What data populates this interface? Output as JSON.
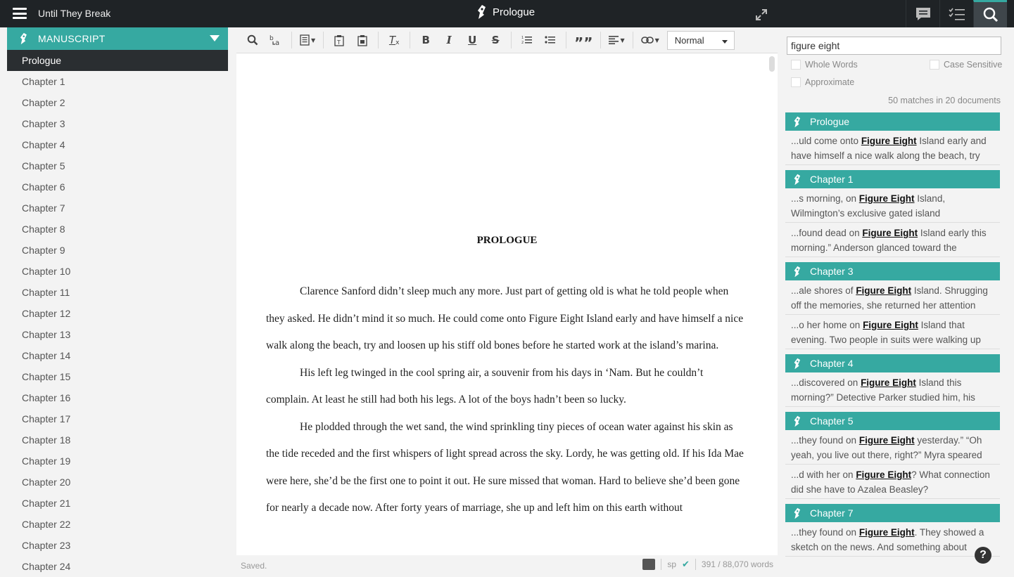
{
  "app": {
    "title": "Until They Break",
    "doc_title": "Prologue"
  },
  "sidebar": {
    "section_label": "MANUSCRIPT",
    "items": [
      "Prologue",
      "Chapter 1",
      "Chapter 2",
      "Chapter 3",
      "Chapter 4",
      "Chapter 5",
      "Chapter 6",
      "Chapter 7",
      "Chapter 8",
      "Chapter 9",
      "Chapter 10",
      "Chapter 11",
      "Chapter 12",
      "Chapter 13",
      "Chapter 14",
      "Chapter 15",
      "Chapter 16",
      "Chapter 17",
      "Chapter 18",
      "Chapter 19",
      "Chapter 20",
      "Chapter 21",
      "Chapter 22",
      "Chapter 23",
      "Chapter 24"
    ],
    "active_index": 0
  },
  "toolbar": {
    "style_select_value": "Normal"
  },
  "editor": {
    "heading": "PROLOGUE",
    "paragraphs": [
      "Clarence Sanford didn’t sleep much any more. Just part of getting old is what he told people when they asked. He didn’t mind it so much. He could come onto Figure Eight Island early and have himself a nice walk along the beach, try and loosen up his stiff old bones before he started work at the island’s marina.",
      "His left leg twinged in the cool spring air, a souvenir from his days in ‘Nam. But he couldn’t complain. At least he still had both his legs. A lot of the boys hadn’t been so lucky.",
      "He plodded through the wet sand, the wind sprinkling tiny pieces of ocean water against his skin as the tide receded and the first whispers of light spread across the sky. Lordy, he was getting old. If his Ida Mae were here, she’d be the first one to point it out. He sure missed that woman. Hard to believe she’d been gone for nearly a decade now. After forty years of marriage, she up and left him on this earth without"
    ]
  },
  "status": {
    "saved": "Saved.",
    "spell": "sp",
    "word_count": "391 / 88,070 words"
  },
  "search": {
    "query": "figure eight",
    "options": {
      "whole_words": "Whole Words",
      "case_sensitive": "Case Sensitive",
      "approximate": "Approximate"
    },
    "match_count": "50 matches in 20 documents",
    "results": [
      {
        "doc": "Prologue",
        "snippets": [
          {
            "pre": "...uld come onto ",
            "hl": "Figure Eight",
            "post": " Island early and have himself a nice walk along the beach, try"
          }
        ]
      },
      {
        "doc": "Chapter 1",
        "snippets": [
          {
            "pre": "...s morning, on ",
            "hl": "Figure Eight",
            "post": " Island, Wilmington’s exclusive gated island"
          },
          {
            "pre": "...found dead on ",
            "hl": "Figure Eight",
            "post": " Island early this morning.” Anderson glanced toward the"
          }
        ]
      },
      {
        "doc": "Chapter 3",
        "snippets": [
          {
            "pre": "...ale shores of ",
            "hl": "Figure Eight",
            "post": " Island. Shrugging off the memories, she returned her attention"
          },
          {
            "pre": "...o her home on ",
            "hl": "Figure Eight",
            "post": " Island that evening. Two people in suits were walking up"
          }
        ]
      },
      {
        "doc": "Chapter 4",
        "snippets": [
          {
            "pre": "...discovered on ",
            "hl": "Figure Eight",
            "post": " Island this morning?” Detective Parker studied him, his"
          }
        ]
      },
      {
        "doc": "Chapter 5",
        "snippets": [
          {
            "pre": "...they found on ",
            "hl": "Figure Eight",
            "post": " yesterday.” “Oh yeah, you live out there, right?” Myra speared"
          },
          {
            "pre": "...d with her on ",
            "hl": "Figure Eight",
            "post": "? What connection did she have to Azalea Beasley?"
          }
        ]
      },
      {
        "doc": "Chapter 7",
        "snippets": [
          {
            "pre": "...they found on ",
            "hl": "Figure Eight",
            "post": ". They showed a sketch on the news. And something about"
          }
        ]
      }
    ]
  },
  "help_label": "?"
}
